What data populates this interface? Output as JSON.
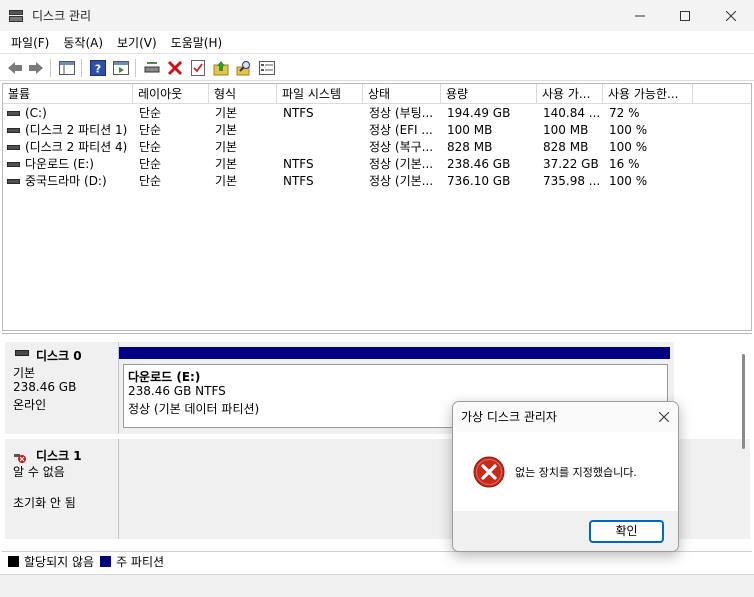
{
  "window": {
    "title": "디스크 관리"
  },
  "menu": [
    "파일(F)",
    "동작(A)",
    "보기(V)",
    "도움말(H)"
  ],
  "table": {
    "columns": [
      "볼륨",
      "레이아웃",
      "형식",
      "파일 시스템",
      "상태",
      "용량",
      "사용 가...",
      "사용 가능한..."
    ],
    "rows": [
      [
        "(C:)",
        "단순",
        "기본",
        "NTFS",
        "정상 (부팅...",
        "194.49 GB",
        "140.84 ...",
        "72 %"
      ],
      [
        "(디스크 2 파티션 1)",
        "단순",
        "기본",
        "",
        "정상 (EFI ...",
        "100 MB",
        "100 MB",
        "100 %"
      ],
      [
        "(디스크 2 파티션 4)",
        "단순",
        "기본",
        "",
        "정상 (복구...",
        "828 MB",
        "828 MB",
        "100 %"
      ],
      [
        "다운로드 (E:)",
        "단순",
        "기본",
        "NTFS",
        "정상 (기본...",
        "238.46 GB",
        "37.22 GB",
        "16 %"
      ],
      [
        "중국드라마 (D:)",
        "단순",
        "기본",
        "NTFS",
        "정상 (기본...",
        "736.10 GB",
        "735.98 ...",
        "100 %"
      ]
    ]
  },
  "disk0": {
    "name": "디스크 0",
    "type": "기본",
    "size": "238.46 GB",
    "status": "온라인",
    "partition": {
      "name": "다운로드 (E:)",
      "size_fs": "238.46 GB NTFS",
      "status": "정상 (기본 데이터 파티션)"
    }
  },
  "disk1": {
    "name": "디스크 1",
    "status1": "알 수 없음",
    "status2": "초기화 안 됨"
  },
  "legend": [
    {
      "color": "#000000",
      "label": "할당되지 않음"
    },
    {
      "color": "#000080",
      "label": "주 파티션"
    }
  ],
  "dialog": {
    "title": "가상 디스크 관리자",
    "message": "없는 장치를 지정했습니다.",
    "ok_label": "확인"
  }
}
